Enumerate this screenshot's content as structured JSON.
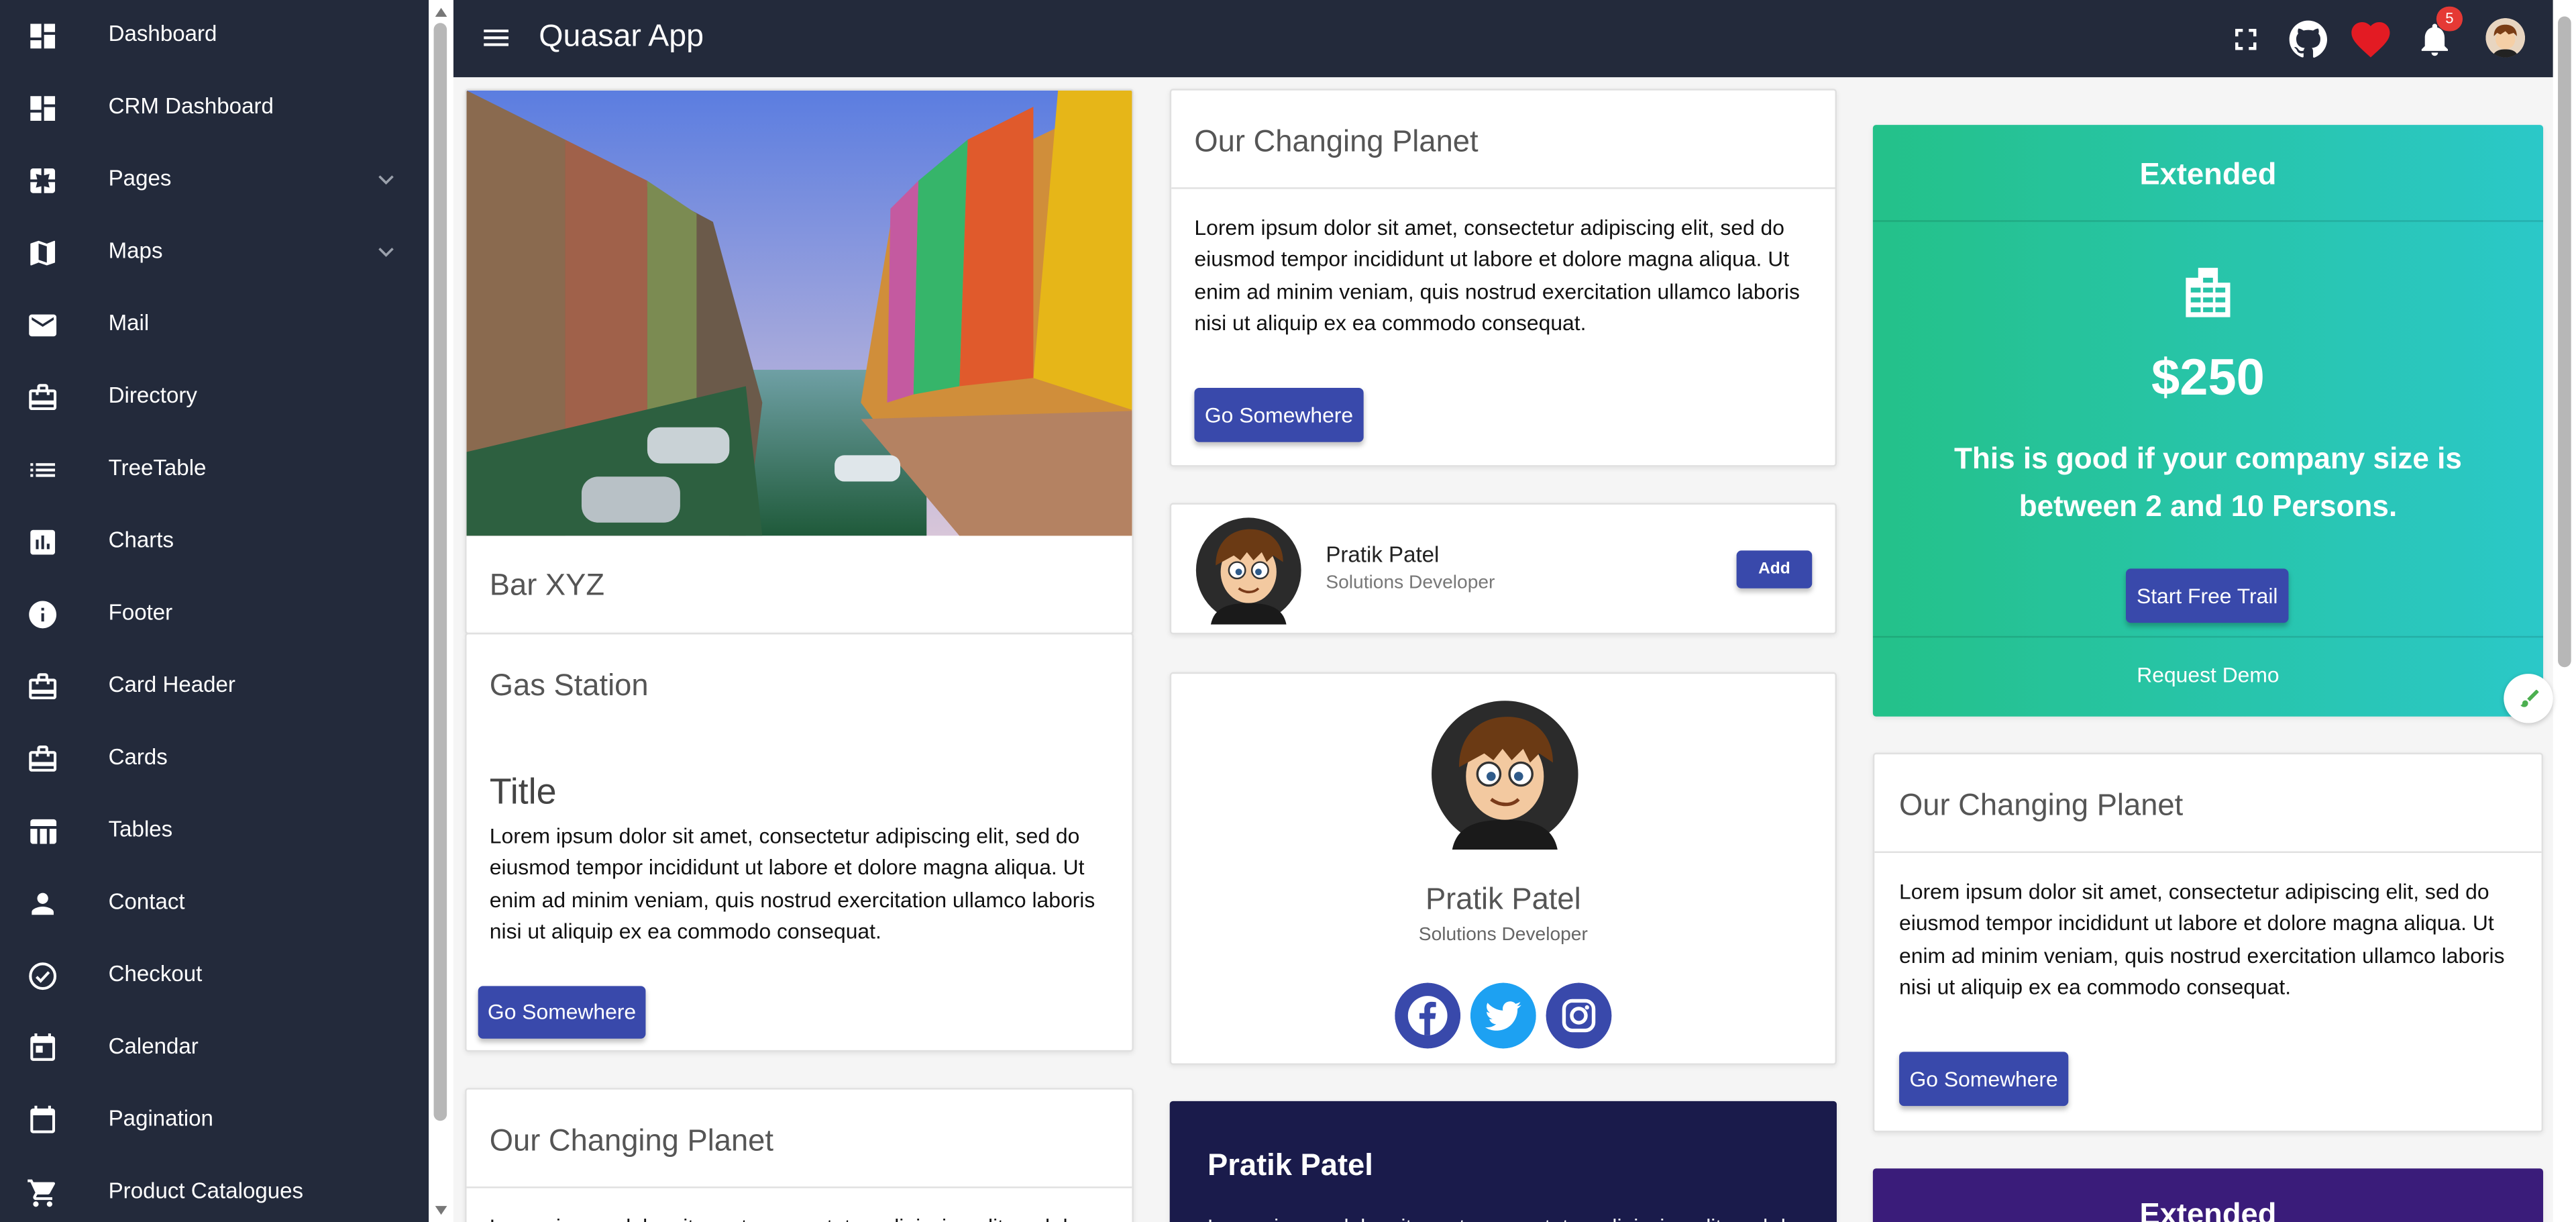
{
  "app": {
    "title": "Quasar App"
  },
  "sidebar": {
    "items": [
      {
        "label": "Dashboard",
        "icon": "dashboard-icon"
      },
      {
        "label": "CRM Dashboard",
        "icon": "dashboard-icon"
      },
      {
        "label": "Pages",
        "icon": "pages-icon",
        "expandable": true
      },
      {
        "label": "Maps",
        "icon": "map-icon",
        "expandable": true
      },
      {
        "label": "Mail",
        "icon": "mail-icon"
      },
      {
        "label": "Directory",
        "icon": "card-icon"
      },
      {
        "label": "TreeTable",
        "icon": "list-icon"
      },
      {
        "label": "Charts",
        "icon": "chart-icon"
      },
      {
        "label": "Footer",
        "icon": "info-icon"
      },
      {
        "label": "Card Header",
        "icon": "card-icon"
      },
      {
        "label": "Cards",
        "icon": "card-icon"
      },
      {
        "label": "Tables",
        "icon": "table-icon"
      },
      {
        "label": "Contact",
        "icon": "person-icon"
      },
      {
        "label": "Checkout",
        "icon": "check-circle-icon"
      },
      {
        "label": "Calendar",
        "icon": "calendar-icon"
      },
      {
        "label": "Pagination",
        "icon": "calendar-icon"
      },
      {
        "label": "Product Catalogues",
        "icon": "cart-icon"
      }
    ]
  },
  "header": {
    "notification_count": "5",
    "icons": [
      "fullscreen-icon",
      "github-icon",
      "heart-icon",
      "bell-icon",
      "avatar"
    ]
  },
  "colors": {
    "sidebar_bg": "#232a3b",
    "primary": "#3949ab",
    "pricing_gradient": [
      "#24c189",
      "#2bc8c8"
    ],
    "dark_card": "#1a1b4b",
    "purple_card": "#3a1c7a"
  },
  "col1": {
    "image_card": {
      "title": "Bar XYZ"
    },
    "gas_card": {
      "heading": "Gas Station",
      "title": "Title",
      "text": "Lorem ipsum dolor sit amet, consectetur adipiscing elit, sed do eiusmod tempor incididunt ut labore et dolore magna aliqua. Ut enim ad minim veniam, quis nostrud exercitation ullamco laboris nisi ut aliquip ex ea commodo consequat.",
      "button": "Go Somewhere"
    },
    "bottom_card": {
      "title": "Our Changing Planet",
      "text": "Lorem ipsum dolor sit amet, consectetur adipiscing elit, sed do"
    }
  },
  "col2": {
    "planet_card": {
      "title": "Our Changing Planet",
      "text": "Lorem ipsum dolor sit amet, consectetur adipiscing elit, sed do eiusmod tempor incididunt ut labore et dolore magna aliqua. Ut enim ad minim veniam, quis nostrud exercitation ullamco laboris nisi ut aliquip ex ea commodo consequat.",
      "button": "Go Somewhere"
    },
    "user_row": {
      "name": "Pratik Patel",
      "role": "Solutions Developer",
      "button": "Add"
    },
    "profile_card": {
      "name": "Pratik Patel",
      "role": "Solutions Developer",
      "social": [
        "facebook-icon",
        "twitter-icon",
        "instagram-icon"
      ]
    },
    "dark_card": {
      "name": "Pratik Patel",
      "text": "Lorem ipsum dolor sit amet, consectetur adipiscing elit, sed do"
    }
  },
  "col3": {
    "pricing": {
      "title": "Extended",
      "price": "$250",
      "desc": "This is good if your company size is between 2 and 10 Persons.",
      "button": "Start Free Trail",
      "link": "Request Demo"
    },
    "planet_card": {
      "title": "Our Changing Planet",
      "text": "Lorem ipsum dolor sit amet, consectetur adipiscing elit, sed do eiusmod tempor incididunt ut labore et dolore magna aliqua. Ut enim ad minim veniam, quis nostrud exercitation ullamco laboris nisi ut aliquip ex ea commodo consequat.",
      "button": "Go Somewhere"
    },
    "purple_card": {
      "title": "Extended"
    }
  }
}
